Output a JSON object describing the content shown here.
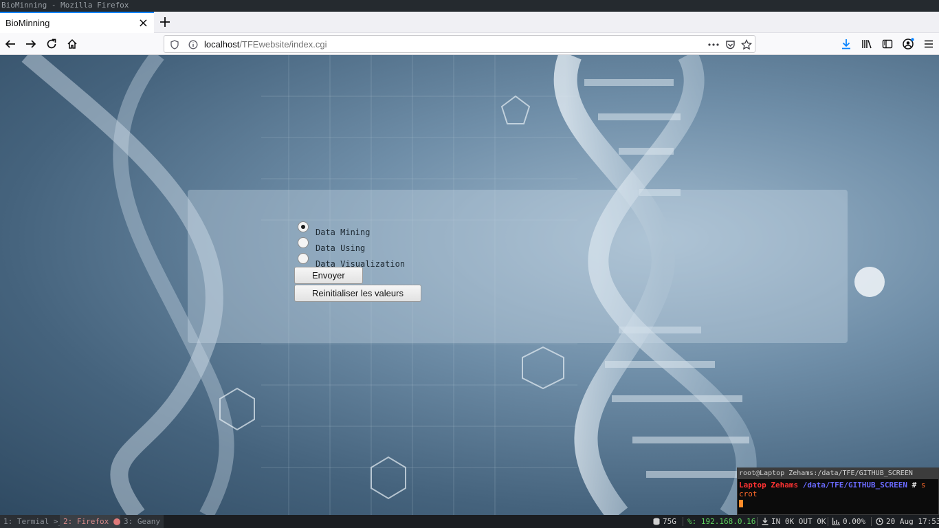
{
  "window": {
    "title": "BioMinning - Mozilla Firefox"
  },
  "browser": {
    "tab_title": "BioMinning",
    "url_host": "localhost",
    "url_path": "/TFEwebsite/index.cgi",
    "accent": "#0a84ff"
  },
  "form": {
    "options": [
      {
        "label": "Data Mining",
        "checked": true
      },
      {
        "label": "Data Using",
        "checked": false
      },
      {
        "label": "Data Visualization",
        "checked": false
      }
    ],
    "submit_label": "Envoyer",
    "reset_label": "Reinitialiser les valeurs"
  },
  "terminal": {
    "title": "root@Laptop Zehams:/data/TFE/GITHUB_SCREEN",
    "prompt_host": "Laptop Zehams",
    "prompt_path": "/data/TFE/GITHUB_SCREEN",
    "prompt_hash": "#",
    "command_line1": "s",
    "command_line2": "crot"
  },
  "statusbar": {
    "workspaces": [
      {
        "label": "1: Termial >_",
        "active": false
      },
      {
        "label": "2: Firefox",
        "active": true
      },
      {
        "label": "3: Geany",
        "active": false
      }
    ],
    "disk": "75G",
    "ip": "%: 192.168.0.16",
    "net": "IN 0K OUT 0K",
    "cpu": "0.00%",
    "datetime": "20 Aug 17:53"
  }
}
